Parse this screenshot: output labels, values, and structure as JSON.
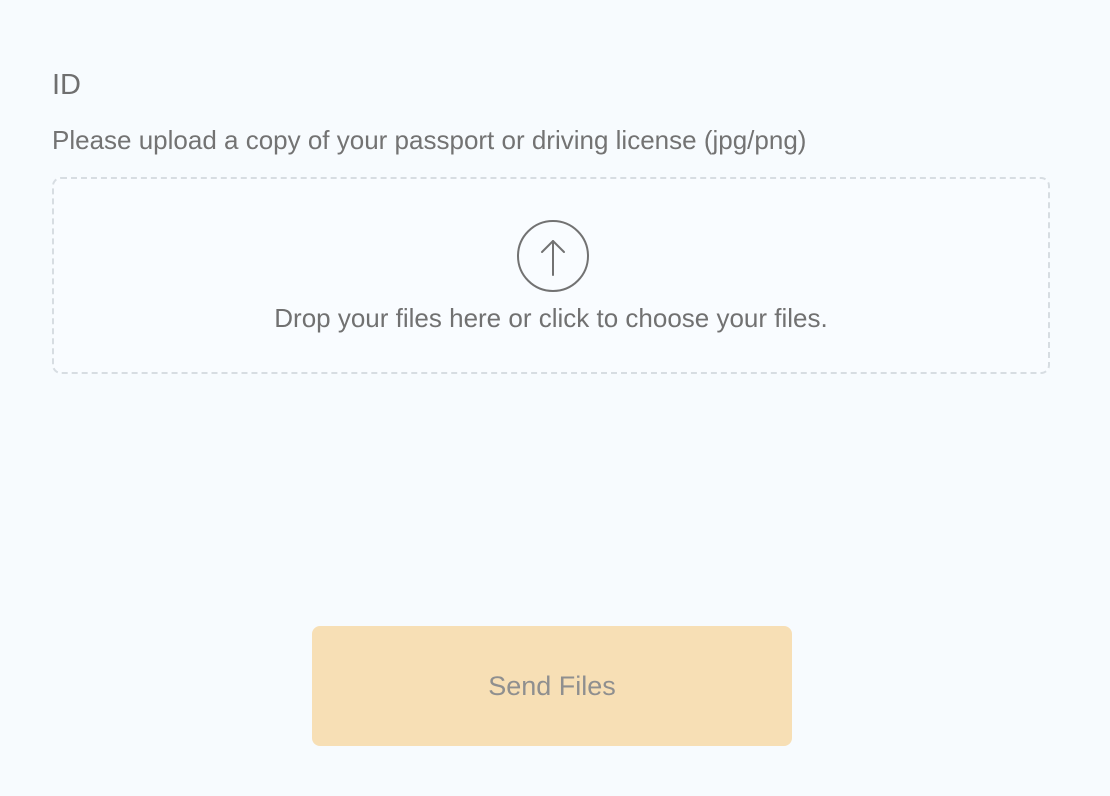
{
  "form": {
    "field_title": "ID",
    "help_text": "Please upload a copy of your passport or driving license (jpg/png)",
    "dropzone": {
      "icon": "upload-arrow-circle-icon",
      "message": "Drop your files here or click to choose your files."
    },
    "send_button_label": "Send Files"
  },
  "colors": {
    "background": "#f7fbfe",
    "text": "#6f6f6f",
    "dropzone_border": "#d7dde2",
    "button_background": "#f7dfb5",
    "button_text": "#8f8f8f"
  }
}
